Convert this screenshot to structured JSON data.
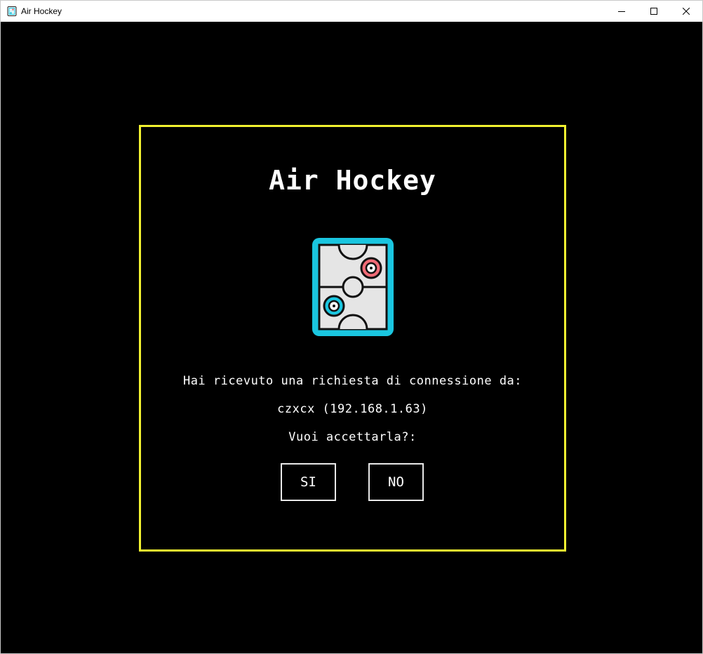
{
  "window": {
    "title": "Air Hockey",
    "app_icon": "air-hockey-app-icon",
    "controls": {
      "minimize_icon": "minimize-icon",
      "maximize_icon": "maximize-icon",
      "close_icon": "close-icon"
    }
  },
  "dialog": {
    "title": "Air Hockey",
    "logo_icon": "air-hockey-table-icon",
    "message_line_1": "Hai ricevuto una richiesta di connessione da:",
    "requester": "czxcx (192.168.1.63)",
    "question": "Vuoi accettarla?:",
    "accept_label": "SI",
    "reject_label": "NO"
  },
  "colors": {
    "background": "#000000",
    "dialog_border": "#f2f230",
    "text": "#ffffff",
    "table_frame": "#1ac6e0",
    "table_surface": "#e5e5e5",
    "mallet_red": "#f06b76",
    "mallet_blue": "#1ac6e0"
  }
}
